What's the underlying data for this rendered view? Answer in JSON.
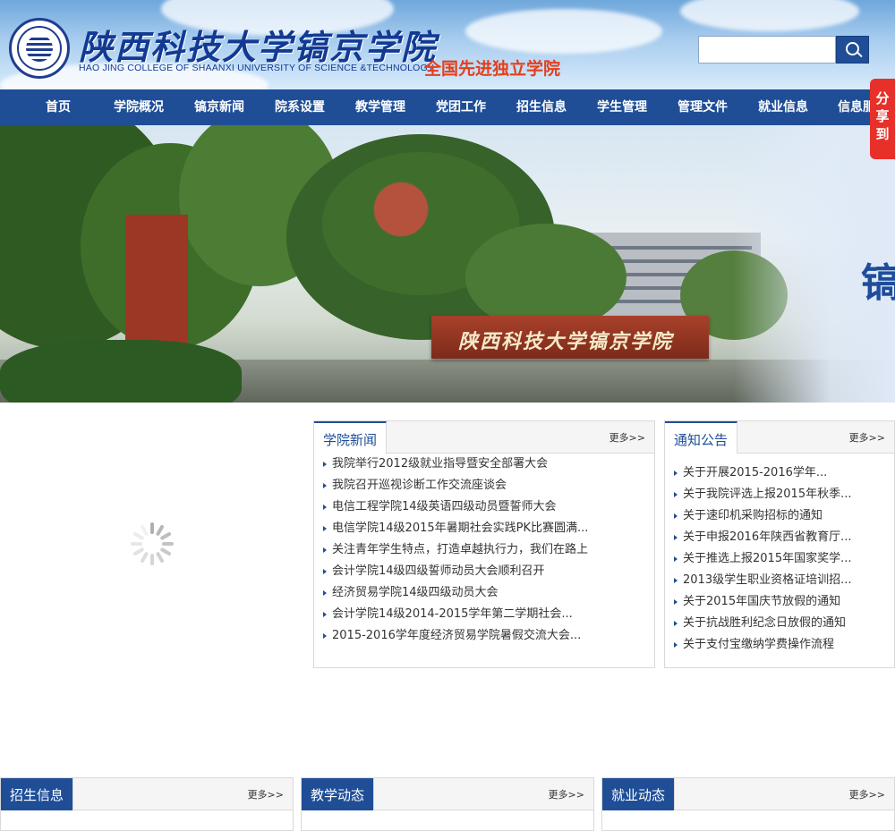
{
  "header": {
    "title_cn": "陕西科技大学镐京学院",
    "title_en": "HAO JING COLLEGE OF SHAANXI UNIVERSITY OF SCIENCE &TECHNOLOGY",
    "slogan": "全国先进独立学院",
    "search_placeholder": "",
    "search_icon": "search-icon"
  },
  "nav": {
    "items": [
      {
        "label": "首页"
      },
      {
        "label": "学院概况"
      },
      {
        "label": "镐京新闻"
      },
      {
        "label": "院系设置"
      },
      {
        "label": "教学管理"
      },
      {
        "label": "党团工作"
      },
      {
        "label": "招生信息"
      },
      {
        "label": "学生管理"
      },
      {
        "label": "管理文件"
      },
      {
        "label": "就业信息"
      },
      {
        "label": "信息服务"
      }
    ]
  },
  "share": {
    "label": "分享到"
  },
  "banner": {
    "sign_text": "陕西科技大学镐京学院",
    "edge_char": "镐"
  },
  "news": {
    "title": "学院新闻",
    "more": "更多>>",
    "items": [
      "我院举行2012级就业指导暨安全部署大会",
      "我院召开巡视诊断工作交流座谈会",
      "电信工程学院14级英语四级动员暨誓师大会",
      "电信学院14级2015年暑期社会实践PK比赛圆满...",
      "关注青年学生特点，打造卓越执行力，我们在路上",
      "会计学院14级四级誓师动员大会顺利召开",
      "经济贸易学院14级四级动员大会",
      "会计学院14级2014-2015学年第二学期社会...",
      "2015-2016学年度经济贸易学院暑假交流大会..."
    ]
  },
  "notices": {
    "title": "通知公告",
    "more": "更多>>",
    "items": [
      "关于开展2015-2016学年...",
      "关于我院评选上报2015年秋季...",
      "关于速印机采购招标的通知",
      "关于申报2016年陕西省教育厅...",
      "关于推选上报2015年国家奖学...",
      "2013级学生职业资格证培训招...",
      "关于2015年国庆节放假的通知",
      "关于抗战胜利纪念日放假的通知",
      "关于支付宝缴纳学费操作流程"
    ]
  },
  "bottom": {
    "admissions": {
      "title": "招生信息",
      "more": "更多>>"
    },
    "teaching": {
      "title": "教学动态",
      "more": "更多>>"
    },
    "employment": {
      "title": "就业动态",
      "more": "更多>>"
    }
  },
  "colors": {
    "brand_blue": "#1f4e97",
    "slogan_red": "#e2401d",
    "share_red": "#e8302a"
  }
}
